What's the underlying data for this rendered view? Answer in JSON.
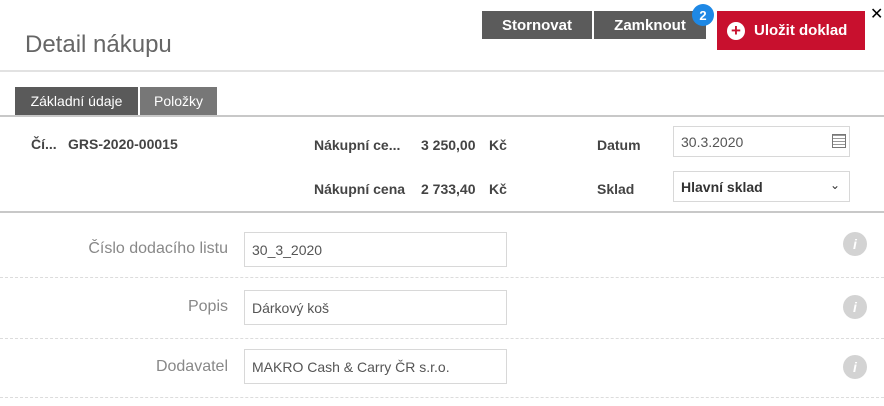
{
  "header": {
    "title": "Detail nákupu",
    "cancel_label": "Stornovat",
    "lock_label": "Zamknout",
    "lock_badge": "2",
    "save_label": "Uložit doklad",
    "close_glyph": "✕"
  },
  "tabs": [
    {
      "label": "Základní údaje",
      "active": true
    },
    {
      "label": "Položky",
      "active": false
    }
  ],
  "summary": {
    "number_label": "Čí...",
    "number_value": "GRS-2020-00015",
    "price1_label": "Nákupní ce...",
    "price1_value": "3 250,00",
    "price1_currency": "Kč",
    "price2_label": "Nákupní cena",
    "price2_value": "2 733,40",
    "price2_currency": "Kč",
    "date_label": "Datum",
    "date_value": "30.3.2020",
    "warehouse_label": "Sklad",
    "warehouse_value": "Hlavní sklad"
  },
  "fields": {
    "delivery_note_label": "Číslo dodacího listu",
    "delivery_note_value": "30_3_2020",
    "description_label": "Popis",
    "description_value": "Dárkový koš",
    "supplier_label": "Dodavatel",
    "supplier_value": "MAKRO Cash & Carry ČR s.r.o."
  },
  "icons": {
    "calendar": "calendar-icon",
    "info": "info-icon",
    "chevron": "chevron-down-icon",
    "plus": "plus-circle-icon",
    "close": "close-icon"
  },
  "colors": {
    "save_button": "#c8102e",
    "dark_button": "#5b5b5b",
    "badge": "#1e88e5",
    "info_icon": "#d3d3d3"
  }
}
